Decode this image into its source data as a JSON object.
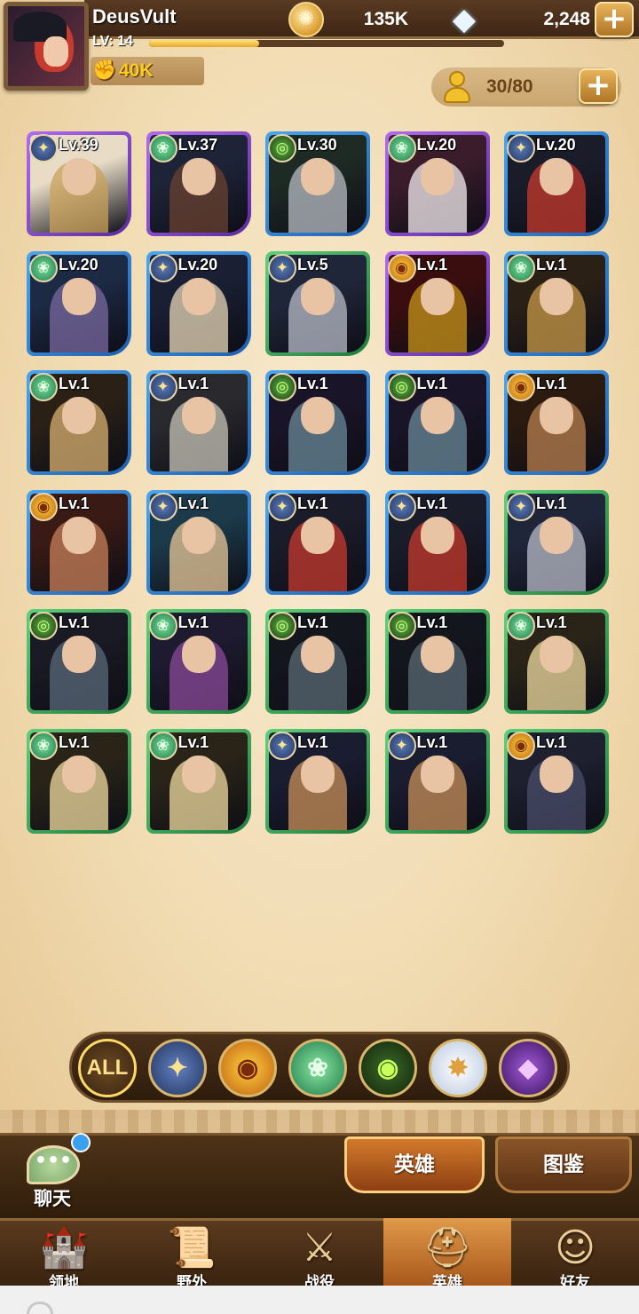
{
  "player": {
    "name": "DeusVult",
    "level_label": "LV: 14",
    "xp_progress": 0.31,
    "power": "40K"
  },
  "currencies": {
    "gold": "135K",
    "gems": "2,248",
    "plus_glyph": "+"
  },
  "roster": {
    "count": "30/80",
    "plus_glyph": "+"
  },
  "heroes": [
    {
      "level": "Lv.39",
      "faction": "light",
      "rarity": "purple",
      "palette": [
        "#e8dcc6",
        "#c9a25a"
      ]
    },
    {
      "level": "Lv.37",
      "faction": "wild",
      "rarity": "purple",
      "palette": [
        "#1e2438",
        "#6a4230"
      ]
    },
    {
      "level": "Lv.30",
      "faction": "grave",
      "rarity": "blue",
      "palette": [
        "#1e2a24",
        "#b8bcc4"
      ]
    },
    {
      "level": "Lv.20",
      "faction": "wild",
      "rarity": "purple",
      "palette": [
        "#3a1c2a",
        "#f4eef0"
      ]
    },
    {
      "level": "Lv.20",
      "faction": "light",
      "rarity": "blue",
      "palette": [
        "#1a1c2a",
        "#c73a2e"
      ]
    },
    {
      "level": "Lv.20",
      "faction": "wild",
      "rarity": "blue",
      "palette": [
        "#1c2a44",
        "#7a6aa0"
      ]
    },
    {
      "level": "Lv.20",
      "faction": "light",
      "rarity": "blue",
      "palette": [
        "#1a1f34",
        "#e8d8b8"
      ]
    },
    {
      "level": "Lv.5",
      "faction": "light",
      "rarity": "green",
      "palette": [
        "#20263a",
        "#b8bcc8"
      ]
    },
    {
      "level": "Lv.1",
      "faction": "mauler",
      "rarity": "purple",
      "palette": [
        "#3a0e0e",
        "#c8941a"
      ]
    },
    {
      "level": "Lv.1",
      "faction": "wild",
      "rarity": "blue",
      "palette": [
        "#2a2016",
        "#c89a4a"
      ]
    },
    {
      "level": "Lv.1",
      "faction": "wild",
      "rarity": "blue",
      "palette": [
        "#2a2016",
        "#d8b070"
      ]
    },
    {
      "level": "Lv.1",
      "faction": "light",
      "rarity": "blue",
      "palette": [
        "#2a2a2e",
        "#c8c4b8"
      ]
    },
    {
      "level": "Lv.1",
      "faction": "grave",
      "rarity": "blue",
      "palette": [
        "#1a1428",
        "#6a8a9a"
      ]
    },
    {
      "level": "Lv.1",
      "faction": "grave",
      "rarity": "blue",
      "palette": [
        "#1a1428",
        "#6a8a9a"
      ]
    },
    {
      "level": "Lv.1",
      "faction": "mauler",
      "rarity": "blue",
      "palette": [
        "#2a1a10",
        "#b88050"
      ]
    },
    {
      "level": "Lv.1",
      "faction": "mauler",
      "rarity": "blue",
      "palette": [
        "#3a1a14",
        "#c8805a"
      ]
    },
    {
      "level": "Lv.1",
      "faction": "light",
      "rarity": "blue",
      "palette": [
        "#1c3a4a",
        "#e8c898"
      ]
    },
    {
      "level": "Lv.1",
      "faction": "light",
      "rarity": "blue",
      "palette": [
        "#1a1c2a",
        "#c73a2e"
      ]
    },
    {
      "level": "Lv.1",
      "faction": "light",
      "rarity": "blue",
      "palette": [
        "#1a1c2a",
        "#c73a2e"
      ]
    },
    {
      "level": "Lv.1",
      "faction": "light",
      "rarity": "green",
      "palette": [
        "#20263a",
        "#b8bcc8"
      ]
    },
    {
      "level": "Lv.1",
      "faction": "grave",
      "rarity": "green",
      "palette": [
        "#1a1a24",
        "#5a6a7a"
      ]
    },
    {
      "level": "Lv.1",
      "faction": "wild",
      "rarity": "green",
      "palette": [
        "#1e1a30",
        "#8a4a9a"
      ]
    },
    {
      "level": "Lv.1",
      "faction": "grave",
      "rarity": "green",
      "palette": [
        "#14161e",
        "#5a6a74"
      ]
    },
    {
      "level": "Lv.1",
      "faction": "grave",
      "rarity": "green",
      "palette": [
        "#14161e",
        "#5a6a74"
      ]
    },
    {
      "level": "Lv.1",
      "faction": "wild",
      "rarity": "green",
      "palette": [
        "#2a2418",
        "#f0dca0"
      ]
    },
    {
      "level": "Lv.1",
      "faction": "wild",
      "rarity": "green",
      "palette": [
        "#2a2418",
        "#f0dca0"
      ]
    },
    {
      "level": "Lv.1",
      "faction": "wild",
      "rarity": "green",
      "palette": [
        "#2a2418",
        "#f0dca0"
      ]
    },
    {
      "level": "Lv.1",
      "faction": "light",
      "rarity": "green",
      "palette": [
        "#1a1c30",
        "#c8905a"
      ]
    },
    {
      "level": "Lv.1",
      "faction": "light",
      "rarity": "green",
      "palette": [
        "#1a1c30",
        "#c8905a"
      ]
    },
    {
      "level": "Lv.1",
      "faction": "mauler",
      "rarity": "green",
      "palette": [
        "#1e2030",
        "#4a4e6a"
      ]
    }
  ],
  "faction_icons": {
    "light": "✦",
    "mauler": "◉",
    "wild": "❀",
    "grave": "◎"
  },
  "filters": [
    {
      "id": "all",
      "label": "ALL"
    },
    {
      "id": "light",
      "label": "✦"
    },
    {
      "id": "mauler",
      "label": "◉"
    },
    {
      "id": "wild",
      "label": "❀"
    },
    {
      "id": "grave",
      "label": "◉"
    },
    {
      "id": "celestial",
      "label": "✸"
    },
    {
      "id": "hypo",
      "label": "◆"
    }
  ],
  "chat": {
    "label": "聊天",
    "bubble_glyph": "•••"
  },
  "tabs": {
    "heroes": "英雄",
    "codex": "图鉴"
  },
  "nav": [
    {
      "id": "ranhorn",
      "label": "领地",
      "icon": "castle-icon",
      "glyph": "🏰"
    },
    {
      "id": "field",
      "label": "野外",
      "icon": "map-scroll-icon",
      "glyph": "📜"
    },
    {
      "id": "battle",
      "label": "战役",
      "icon": "sword-shield-icon",
      "glyph": "⚔"
    },
    {
      "id": "heroes",
      "label": "英雄",
      "icon": "helmet-icon",
      "glyph": "⛑",
      "active": true
    },
    {
      "id": "friends",
      "label": "好友",
      "icon": "friends-icon",
      "glyph": "☺"
    }
  ],
  "colors": {
    "parchment": "#f3e1bd",
    "accent_gold": "#ffcc1a",
    "rarity_purple": "#8a4ad0",
    "rarity_blue": "#2a80d0",
    "rarity_green": "#2f9a50"
  }
}
